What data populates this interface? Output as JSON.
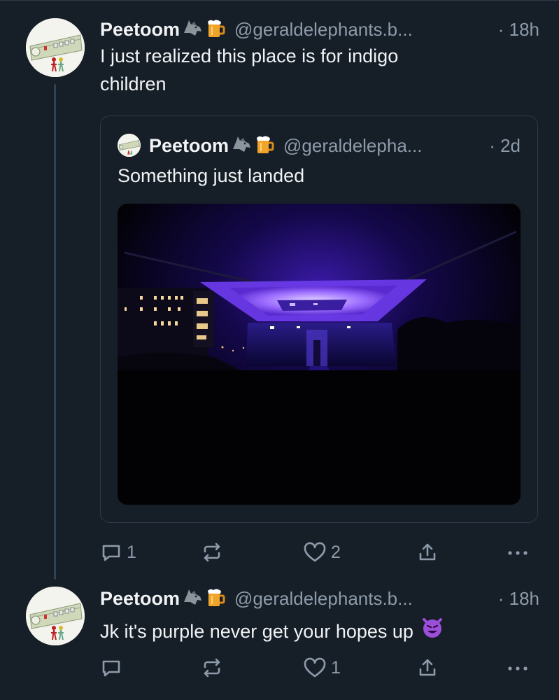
{
  "post1": {
    "name": "Peetoom",
    "handle": "@geraldelephants.b...",
    "time": "· 18h",
    "text_line1": "I just realized this place is for indigo",
    "text_line2": "children",
    "actions": {
      "replies": "1",
      "reposts": "",
      "likes": "2"
    }
  },
  "quote": {
    "name": "Peetoom",
    "handle": "@geraldelepha...",
    "time": "· 2d",
    "text": "Something just landed"
  },
  "post2": {
    "name": "Peetoom",
    "handle": "@geraldelephants.b...",
    "time": "· 18h",
    "text": "Jk it's purple never get your hopes up",
    "actions": {
      "replies": "",
      "reposts": "",
      "likes": "1"
    }
  },
  "icons": {
    "name_emojis": [
      "wolf-emoji",
      "beer-mug-emoji"
    ],
    "post2_emoji": "smiling-devil-emoji",
    "actions": [
      "reply-icon",
      "repost-icon",
      "like-icon",
      "share-icon",
      "more-icon"
    ]
  },
  "colors": {
    "background": "#161e27",
    "text": "#f1f3f5",
    "muted": "#8d9baa",
    "thread_line": "#2f4256",
    "purple_glow": "#8a5cff"
  }
}
